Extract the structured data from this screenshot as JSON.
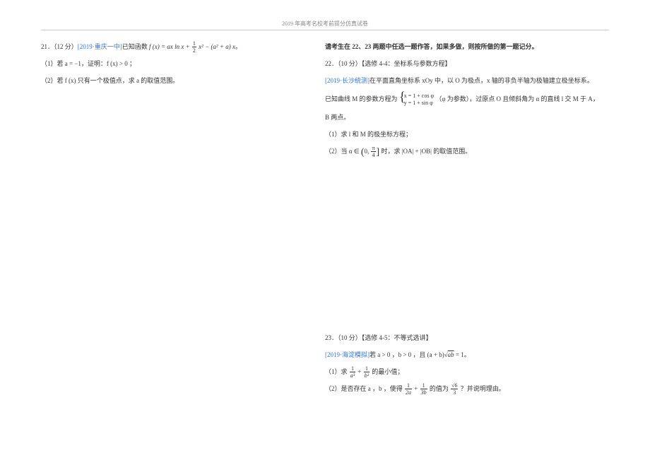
{
  "header": "2019 年高考名校考前提分仿真试卷",
  "left": {
    "q21": {
      "problem_prefix": "21．（12 分）",
      "source": "[2019·重庆一中]",
      "problem_mid": "已知函数",
      "func": "f (x) = ax ln x +",
      "half_num": "1",
      "half_den": "2",
      "func_tail": "x² − (a² + a) x",
      "dot": "。",
      "part1": "（1）若 a = −1，证明：f (x) > 0 ；",
      "part2": "（2）若 f (x) 只有一个极值点，求 a 的取值范围。"
    }
  },
  "right": {
    "notice": "请考生在 22、23 两题中任选一题作答，如果多做，则按所做的第一题记分。",
    "q22": {
      "header": "22．（10 分）【选修 4-4：坐标系与参数方程】",
      "source": "[2019·长沙统测]",
      "l1_tail": "在平面直角坐标系 xOy 中，以 O 为极点，x 轴的非负半轴为极轴建立极坐标系。",
      "l2_prefix": "已知曲线 M 的参数方程为",
      "param_x": "x = 1 + cos φ",
      "param_y": "y = 1 + sin φ",
      "l2_tail": "（φ 为参数），过原点 O 且倾斜角为 α 的直线 l 交 M 于 A，",
      "l3": "B 两点。",
      "part1": "（1）求 l 和 M 的极坐标方程；",
      "part2_before": "（2）当 α ∈",
      "range_left": "(",
      "range_inner_a": "0,",
      "range_pi_num": "π",
      "range_pi_den": "4",
      "range_right": "]",
      "part2_after": " 时，求 |OA| + |OB| 的取值范围。"
    },
    "q23": {
      "header": "23．（10 分）【选修 4-5：不等式选讲】",
      "source": "[2019·海淀模拟]",
      "l1_tail": "若 a > 0 ，b > 0 ，且 (a + b)",
      "sqrt": "√",
      "sqrt_inner": "ab",
      "eq1": " = 1。",
      "part1_before": "（1）求",
      "p1_t1_num": "1",
      "p1_t1_den": "a³",
      "plus": " + ",
      "p1_t2_num": "1",
      "p1_t2_den": "b³",
      "part1_after": " 的最小值；",
      "part2_before": "（2）是否存在 a ，b ，使得",
      "p2_t1_num": "1",
      "p2_t1_den": "2a",
      "p2_t2_num": "1",
      "p2_t2_den": "3b",
      "part2_mid": " 的值为",
      "p2_rhs_num": "√6",
      "p2_rhs_den": "3",
      "part2_after": " ？并说明理由。"
    }
  }
}
